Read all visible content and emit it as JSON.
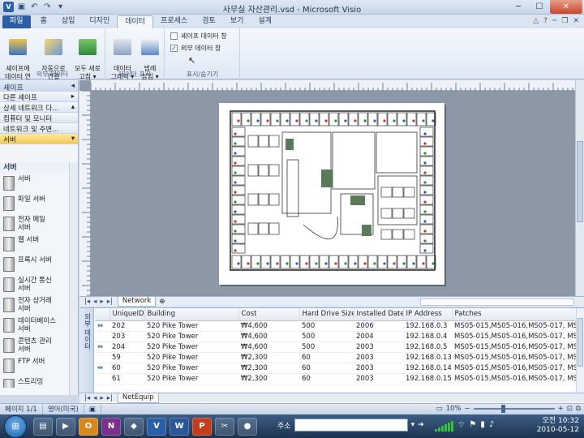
{
  "window": {
    "title": "사무실 자산관리.vsd - Microsoft Visio"
  },
  "ribbon": {
    "tabs": [
      "파일",
      "홈",
      "삽입",
      "디자인",
      "데이터",
      "프로세스",
      "검토",
      "보기",
      "설계"
    ],
    "active_tab": "데이터",
    "groups": [
      {
        "label": "외부 데이터",
        "buttons": [
          "셰이프에\n데이터 연결",
          "자동으로\n연결",
          "모두 새로\n고침 ▾"
        ]
      },
      {
        "label": "데이터 표시",
        "buttons": [
          "데이터\n그래픽 ▾",
          "범례\n삽입 ▾"
        ]
      },
      {
        "label": "표시/숨기기",
        "checkboxes": [
          {
            "label": "셰이프 데이터 창",
            "checked": false
          },
          {
            "label": "외부 데이터 창",
            "checked": true
          }
        ]
      }
    ]
  },
  "shapes_pane": {
    "title": "셰이프",
    "stencils": [
      "다른 셰이프",
      "상세 네트워크 다...",
      "컴퓨터 및 모니터",
      "네트워크 및 주변...",
      "서버"
    ],
    "selected_stencil": "서버",
    "list_title": "서버",
    "items": [
      "서버",
      "파일 서버",
      "전자 메일\n서버",
      "웹 서버",
      "프록시 서버",
      "실시간 통신\n서버",
      "전자 상거래\n서버",
      "데이터베이스\n서버",
      "콘텐츠 관리\n서버",
      "FTP 서버",
      "스트리밍"
    ]
  },
  "drawing": {
    "page_tab": "Network"
  },
  "external_data": {
    "pane_label": "외부 데이터",
    "columns": [
      "UniqueID",
      "Building",
      "Cost",
      "Hard Drive Size",
      "Installed Date",
      "IP Address",
      "Patches"
    ],
    "rows": [
      [
        "202",
        "520 Pike Tower",
        "₩4,600",
        "500",
        "2006",
        "192.168.0.3",
        "MS05-015,MS05-016,MS05-017, MS"
      ],
      [
        "203",
        "520 Pike Tower",
        "₩4,600",
        "500",
        "2004",
        "192.168.0.4",
        "MS05-015,MS05-016,MS05-017, MS"
      ],
      [
        "204",
        "520 Pike Tower",
        "₩4,600",
        "500",
        "2003",
        "192.168.0.5",
        "MS05-015,MS05-016,MS05-017, MS"
      ],
      [
        "59",
        "520 Pike Tower",
        "₩2,300",
        "60",
        "2003",
        "192.168.0.13",
        "MS05-015,MS05-016,MS05-017, MS"
      ],
      [
        "60",
        "520 Pike Tower",
        "₩2,300",
        "60",
        "2003",
        "192.168.0.14",
        "MS05-015,MS05-016,MS05-017, MS"
      ],
      [
        "61",
        "520 Pike Tower",
        "₩2,300",
        "60",
        "2003",
        "192.168.0.15",
        "MS05-015,MS05-016,MS05-017, MS"
      ]
    ],
    "sheet_tab": "NetEquip"
  },
  "status_bar": {
    "page": "페이지 1/1",
    "language": "영어(미국)",
    "zoom": "10%"
  },
  "taskbar": {
    "apps": [
      "O",
      "N",
      "V",
      "W",
      "P"
    ],
    "address_label": "주소",
    "time": "오전 10:32",
    "date": "2010-05-12"
  },
  "colors": {
    "accent": "#2a5ea6",
    "selected_stencil": "#f8c94e"
  }
}
